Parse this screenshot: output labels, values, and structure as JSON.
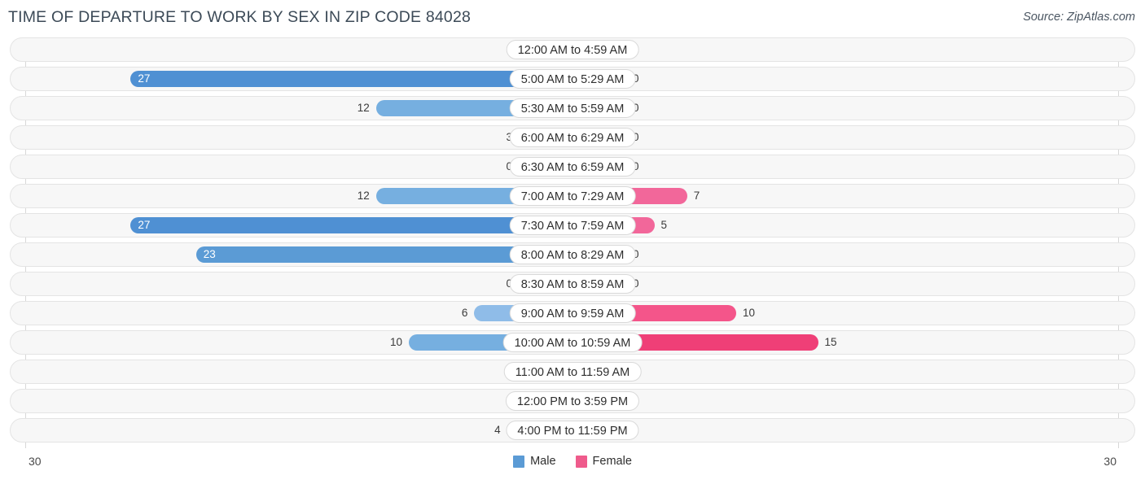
{
  "header": {
    "title": "TIME OF DEPARTURE TO WORK BY SEX IN ZIP CODE 84028",
    "source": "Source: ZipAtlas.com"
  },
  "legend": {
    "male_label": "Male",
    "female_label": "Female",
    "male_color": "#5b9bd5",
    "female_color": "#ef5b8c"
  },
  "axis": {
    "left_min": "30",
    "right_min": "30",
    "max": 30
  },
  "chart_data": {
    "type": "bar",
    "orientation": "horizontal-diverging",
    "title": "TIME OF DEPARTURE TO WORK BY SEX IN ZIP CODE 84028",
    "xlabel": "",
    "ylabel": "",
    "xlim": [
      30,
      30
    ],
    "grid": true,
    "legend_position": "bottom-center",
    "categories": [
      "12:00 AM to 4:59 AM",
      "5:00 AM to 5:29 AM",
      "5:30 AM to 5:59 AM",
      "6:00 AM to 6:29 AM",
      "6:30 AM to 6:59 AM",
      "7:00 AM to 7:29 AM",
      "7:30 AM to 7:59 AM",
      "8:00 AM to 8:29 AM",
      "8:30 AM to 8:59 AM",
      "9:00 AM to 9:59 AM",
      "10:00 AM to 10:59 AM",
      "11:00 AM to 11:59 AM",
      "12:00 PM to 3:59 PM",
      "4:00 PM to 11:59 PM"
    ],
    "series": [
      {
        "name": "Male",
        "values": [
          0,
          27,
          12,
          3,
          0,
          12,
          27,
          23,
          0,
          6,
          10,
          0,
          0,
          4
        ]
      },
      {
        "name": "Female",
        "values": [
          0,
          0,
          0,
          0,
          0,
          7,
          5,
          0,
          0,
          10,
          15,
          0,
          0,
          0
        ]
      }
    ]
  },
  "rows": [
    {
      "label": "12:00 AM to 4:59 AM",
      "male": "0",
      "female": "0",
      "male_val": 0,
      "female_val": 0
    },
    {
      "label": "5:00 AM to 5:29 AM",
      "male": "27",
      "female": "0",
      "male_val": 27,
      "female_val": 0
    },
    {
      "label": "5:30 AM to 5:59 AM",
      "male": "12",
      "female": "0",
      "male_val": 12,
      "female_val": 0
    },
    {
      "label": "6:00 AM to 6:29 AM",
      "male": "3",
      "female": "0",
      "male_val": 3,
      "female_val": 0
    },
    {
      "label": "6:30 AM to 6:59 AM",
      "male": "0",
      "female": "0",
      "male_val": 0,
      "female_val": 0
    },
    {
      "label": "7:00 AM to 7:29 AM",
      "male": "12",
      "female": "7",
      "male_val": 12,
      "female_val": 7
    },
    {
      "label": "7:30 AM to 7:59 AM",
      "male": "27",
      "female": "5",
      "male_val": 27,
      "female_val": 5
    },
    {
      "label": "8:00 AM to 8:29 AM",
      "male": "23",
      "female": "0",
      "male_val": 23,
      "female_val": 0
    },
    {
      "label": "8:30 AM to 8:59 AM",
      "male": "0",
      "female": "0",
      "male_val": 0,
      "female_val": 0
    },
    {
      "label": "9:00 AM to 9:59 AM",
      "male": "6",
      "female": "10",
      "male_val": 6,
      "female_val": 10
    },
    {
      "label": "10:00 AM to 10:59 AM",
      "male": "10",
      "female": "15",
      "male_val": 10,
      "female_val": 15
    },
    {
      "label": "11:00 AM to 11:59 AM",
      "male": "0",
      "female": "0",
      "male_val": 0,
      "female_val": 0
    },
    {
      "label": "12:00 PM to 3:59 PM",
      "male": "0",
      "female": "0",
      "male_val": 0,
      "female_val": 0
    },
    {
      "label": "4:00 PM to 11:59 PM",
      "male": "4",
      "female": "0",
      "male_val": 4,
      "female_val": 0
    }
  ]
}
